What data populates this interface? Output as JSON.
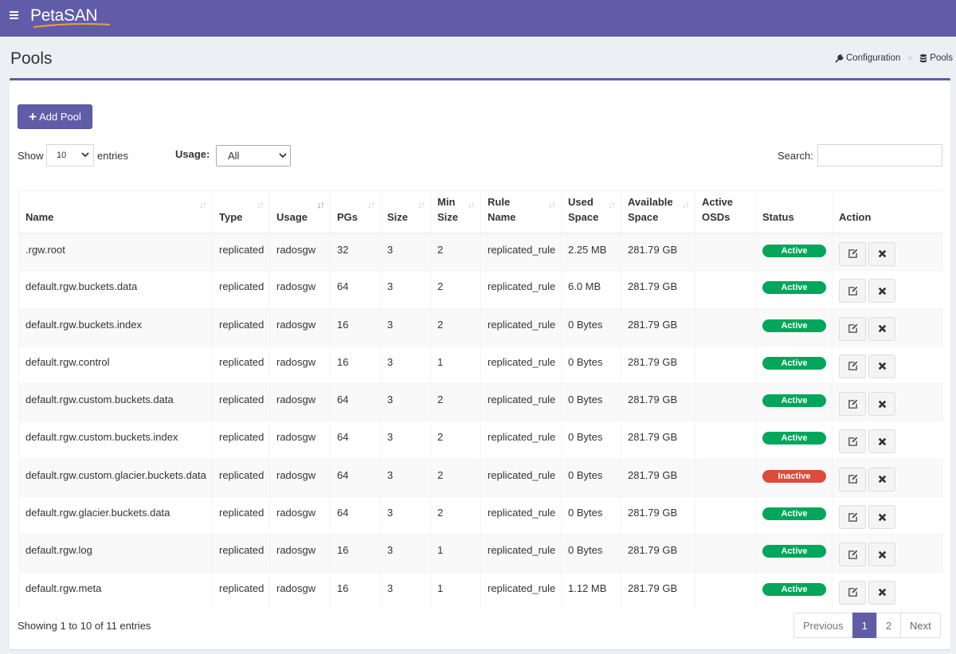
{
  "header": {
    "brand": "PetaSAN",
    "colors": {
      "primary": "#605ca8",
      "success": "#00a65a",
      "danger": "#dd4b39",
      "logo_swoosh": "#f0a030"
    }
  },
  "page": {
    "title": "Pools",
    "breadcrumb": [
      {
        "label": "Configuration",
        "icon": "wrench-icon"
      },
      {
        "label": "Pools",
        "icon": "database-icon"
      }
    ]
  },
  "toolbar": {
    "add_pool_label": "Add Pool",
    "show_label": "Show",
    "entries_value": "10",
    "entries_label": "entries",
    "usage_label": "Usage:",
    "usage_value": "All",
    "search_label": "Search:",
    "search_value": ""
  },
  "table": {
    "columns": [
      {
        "line1": "",
        "line2": "Name",
        "sort": "both"
      },
      {
        "line1": "",
        "line2": "Type",
        "sort": "both"
      },
      {
        "line1": "",
        "line2": "Usage",
        "sort": "asc"
      },
      {
        "line1": "",
        "line2": "PGs",
        "sort": "both"
      },
      {
        "line1": "",
        "line2": "Size",
        "sort": "both"
      },
      {
        "line1": "Min",
        "line2": "Size",
        "sort": "both"
      },
      {
        "line1": "Rule",
        "line2": "Name",
        "sort": "both"
      },
      {
        "line1": "Used",
        "line2": "Space",
        "sort": "both"
      },
      {
        "line1": "Available",
        "line2": "Space",
        "sort": "both"
      },
      {
        "line1": "Active",
        "line2": "OSDs",
        "sort": "none"
      },
      {
        "line1": "",
        "line2": "Status",
        "sort": "none"
      },
      {
        "line1": "",
        "line2": "Action",
        "sort": "none"
      }
    ],
    "rows": [
      {
        "name": ".rgw.root",
        "type": "replicated",
        "usage": "radosgw",
        "pgs": "32",
        "size": "3",
        "min_size": "2",
        "rule": "replicated_rule",
        "used": "2.25 MB",
        "available": "281.79 GB",
        "osds": "",
        "status": "Active",
        "status_kind": "active"
      },
      {
        "name": "default.rgw.buckets.data",
        "type": "replicated",
        "usage": "radosgw",
        "pgs": "64",
        "size": "3",
        "min_size": "2",
        "rule": "replicated_rule",
        "used": "6.0 MB",
        "available": "281.79 GB",
        "osds": "",
        "status": "Active",
        "status_kind": "active"
      },
      {
        "name": "default.rgw.buckets.index",
        "type": "replicated",
        "usage": "radosgw",
        "pgs": "16",
        "size": "3",
        "min_size": "2",
        "rule": "replicated_rule",
        "used": "0 Bytes",
        "available": "281.79 GB",
        "osds": "",
        "status": "Active",
        "status_kind": "active"
      },
      {
        "name": "default.rgw.control",
        "type": "replicated",
        "usage": "radosgw",
        "pgs": "16",
        "size": "3",
        "min_size": "1",
        "rule": "replicated_rule",
        "used": "0 Bytes",
        "available": "281.79 GB",
        "osds": "",
        "status": "Active",
        "status_kind": "active"
      },
      {
        "name": "default.rgw.custom.buckets.data",
        "type": "replicated",
        "usage": "radosgw",
        "pgs": "64",
        "size": "3",
        "min_size": "2",
        "rule": "replicated_rule",
        "used": "0 Bytes",
        "available": "281.79 GB",
        "osds": "",
        "status": "Active",
        "status_kind": "active"
      },
      {
        "name": "default.rgw.custom.buckets.index",
        "type": "replicated",
        "usage": "radosgw",
        "pgs": "64",
        "size": "3",
        "min_size": "2",
        "rule": "replicated_rule",
        "used": "0 Bytes",
        "available": "281.79 GB",
        "osds": "",
        "status": "Active",
        "status_kind": "active"
      },
      {
        "name": "default.rgw.custom.glacier.buckets.data",
        "type": "replicated",
        "usage": "radosgw",
        "pgs": "64",
        "size": "3",
        "min_size": "2",
        "rule": "replicated_rule",
        "used": "0 Bytes",
        "available": "281.79 GB",
        "osds": "",
        "status": "Inactive",
        "status_kind": "inactive"
      },
      {
        "name": "default.rgw.glacier.buckets.data",
        "type": "replicated",
        "usage": "radosgw",
        "pgs": "64",
        "size": "3",
        "min_size": "2",
        "rule": "replicated_rule",
        "used": "0 Bytes",
        "available": "281.79 GB",
        "osds": "",
        "status": "Active",
        "status_kind": "active"
      },
      {
        "name": "default.rgw.log",
        "type": "replicated",
        "usage": "radosgw",
        "pgs": "16",
        "size": "3",
        "min_size": "1",
        "rule": "replicated_rule",
        "used": "0 Bytes",
        "available": "281.79 GB",
        "osds": "",
        "status": "Active",
        "status_kind": "active"
      },
      {
        "name": "default.rgw.meta",
        "type": "replicated",
        "usage": "radosgw",
        "pgs": "16",
        "size": "3",
        "min_size": "1",
        "rule": "replicated_rule",
        "used": "1.12 MB",
        "available": "281.79 GB",
        "osds": "",
        "status": "Active",
        "status_kind": "active"
      }
    ],
    "action_icons": [
      "edit-icon",
      "delete-icon"
    ]
  },
  "footer": {
    "info": "Showing 1 to 10 of 11 entries",
    "pagination": [
      {
        "label": "Previous",
        "current": false,
        "name": "previous"
      },
      {
        "label": "1",
        "current": true,
        "name": "1"
      },
      {
        "label": "2",
        "current": false,
        "name": "2"
      },
      {
        "label": "Next",
        "current": false,
        "name": "next"
      }
    ]
  }
}
